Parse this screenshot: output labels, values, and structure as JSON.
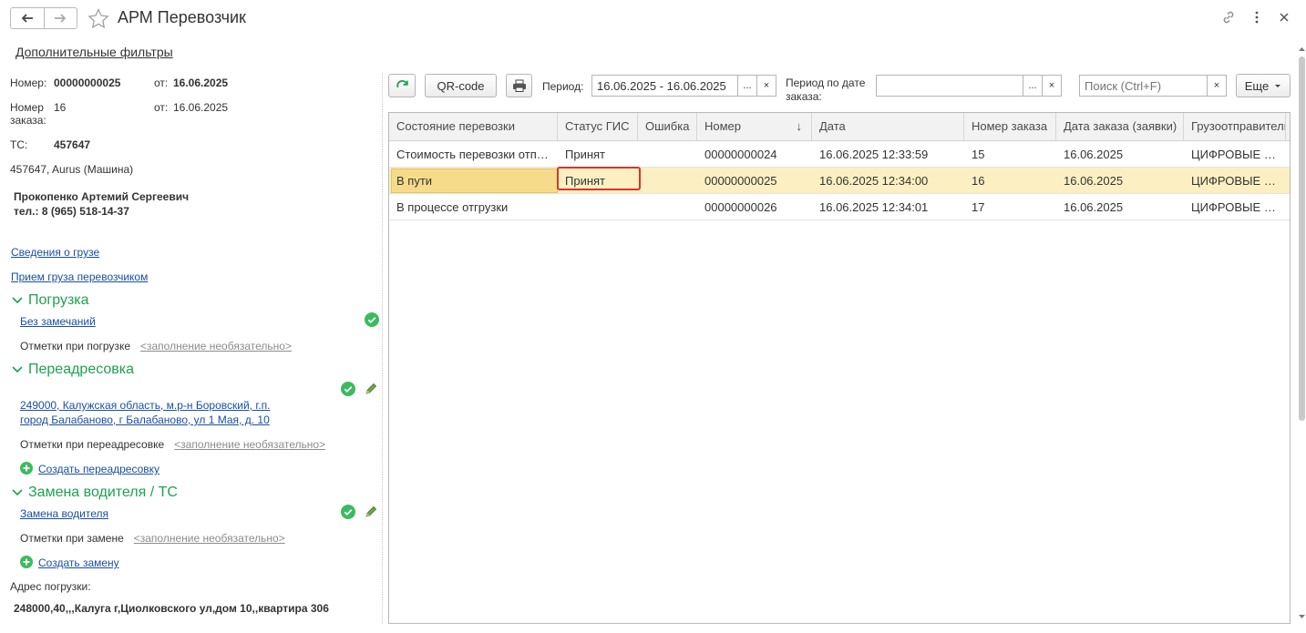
{
  "window": {
    "title": "АРМ Перевозчик",
    "filters_link": "Дополнительные фильтры"
  },
  "left": {
    "number_label": "Номер:",
    "number_value": "00000000025",
    "from_label_1": "от:",
    "from_value_1": "16.06.2025",
    "order_number_label_1": "Номер",
    "order_number_label_2": "заказа:",
    "order_number_value": "16",
    "from_label_2": "от:",
    "from_value_2": "16.06.2025",
    "vehicle_label": "ТС:",
    "vehicle_value": "457647",
    "vehicle_description": "457647, Aurus (Машина)",
    "driver_name": "Прокопенко Артемий Сергеевич",
    "driver_phone": "тел.: 8 (965) 518-14-37",
    "cargo_info_link": "Сведения о грузе",
    "cargo_accept_link": "Прием груза перевозчиком",
    "loading": {
      "title": "Погрузка",
      "status_link": "Без замечаний",
      "notes_label": "Отметки при погрузке",
      "notes_placeholder": "<заполнение необязательно>"
    },
    "redirect": {
      "title": "Переадресовка",
      "address_line_1": "249000, Калужская область, м.р-н Боровский, г.п.",
      "address_line_2": "город Балабаново, г Балабаново, ул 1 Мая, д. 10",
      "notes_label": "Отметки при переадресовке",
      "notes_placeholder": "<заполнение необязательно>",
      "create_link": "Создать переадресовку"
    },
    "driver_change": {
      "title": "Замена водителя / ТС",
      "link": "Замена водителя",
      "notes_label": "Отметки при замене",
      "notes_placeholder": "<заполнение необязательно>",
      "create_link": "Создать замену"
    },
    "loading_address_label": "Адрес погрузки:",
    "loading_address_value": "248000,40,,,Калуга г,Циолковского ул,дом 10,,квартира 306"
  },
  "toolbar": {
    "qr_label": "QR-code",
    "period_label": "Период:",
    "period_value": "16.06.2025 - 16.06.2025",
    "dots": "...",
    "clear": "×",
    "order_period_label_1": "Период по дате",
    "order_period_label_2": "заказа:",
    "order_period_value": "",
    "search_placeholder": "Поиск (Ctrl+F)",
    "more_label": "Еще"
  },
  "table": {
    "columns": [
      "Состояние перевозки",
      "Статус ГИС",
      "Ошибка",
      "Номер",
      "Дата",
      "Номер заказа",
      "Дата заказа (заявки)",
      "Грузоотправитель"
    ],
    "sort_indicator": "↓",
    "rows": [
      {
        "state": "Стоимость перевозки отправлена",
        "gis": "Принят",
        "error": "",
        "number": "00000000024",
        "date": "16.06.2025 12:33:59",
        "order_no": "15",
        "order_date": "16.06.2025",
        "shipper": "ЦИФРОВЫЕ ТЕХНОЛОГИИ"
      },
      {
        "state": "В пути",
        "gis": "Принят",
        "error": "",
        "number": "00000000025",
        "date": "16.06.2025 12:34:00",
        "order_no": "16",
        "order_date": "16.06.2025",
        "shipper": "ЦИФРОВЫЕ ТЕХНОЛОГИИ"
      },
      {
        "state": "В процессе отгрузки",
        "gis": "",
        "error": "",
        "number": "00000000026",
        "date": "16.06.2025 12:34:01",
        "order_no": "17",
        "order_date": "16.06.2025",
        "shipper": "ЦИФРОВЫЕ ТЕХНОЛОГИИ"
      }
    ],
    "selected_row": 1
  },
  "colors": {
    "accent_green": "#1fa14f",
    "link_blue": "#1a4fa3",
    "selected_row": "#fcf0c3",
    "focus_border": "#d9342b"
  }
}
